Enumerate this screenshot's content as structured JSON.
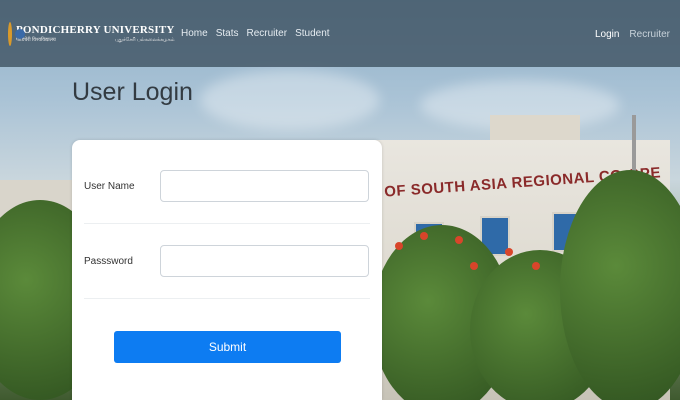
{
  "brand": {
    "name": "PONDICHERRY UNIVERSITY",
    "sub_left": "पांडिचेरी विश्वविद्यालय",
    "sub_right": "புதுச்சேரி பல்கலைக்கழகம்"
  },
  "nav": {
    "left": [
      "Home",
      "Stats",
      "Recruiter",
      "Student"
    ],
    "right": [
      "Login",
      "Recruiter"
    ]
  },
  "page": {
    "title": "User Login"
  },
  "background": {
    "sign_text": "OF SOUTH ASIA REGIONAL CO-OPE"
  },
  "form": {
    "username_label": "User Name",
    "username_value": "",
    "password_label": "Passsword",
    "password_value": "",
    "submit_label": "Submit"
  },
  "colors": {
    "submit": "#0d7cf2",
    "navbar": "#3c505f"
  }
}
